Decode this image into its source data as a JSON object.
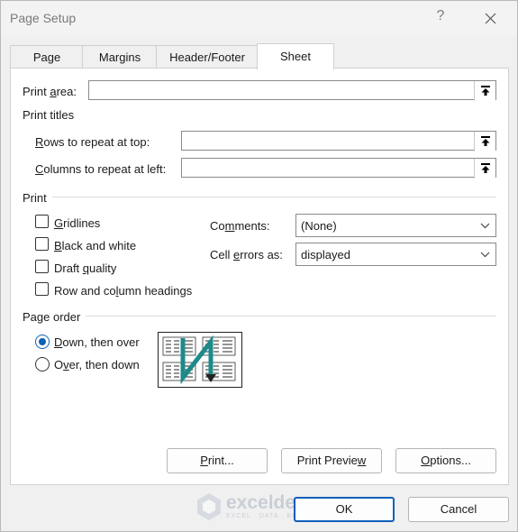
{
  "window": {
    "title": "Page Setup",
    "help_label": "?"
  },
  "tabs": [
    {
      "label": "Page"
    },
    {
      "label": "Margins"
    },
    {
      "label": "Header/Footer"
    },
    {
      "label": "Sheet",
      "active": true
    }
  ],
  "print_area": {
    "label_pre": "Print ",
    "label_u": "a",
    "label_post": "rea:",
    "value": ""
  },
  "print_titles": {
    "label": "Print titles",
    "rows": {
      "label_u": "R",
      "label_post": "ows to repeat at top:",
      "value": ""
    },
    "cols": {
      "label_u": "C",
      "label_post": "olumns to repeat at left:",
      "value": ""
    }
  },
  "print_group": {
    "label": "Print",
    "gridlines": {
      "label_u": "G",
      "label_post": "ridlines",
      "checked": false
    },
    "black_white": {
      "label_u": "B",
      "label_post": "lack and white",
      "checked": false
    },
    "draft": {
      "label_pre": "Draft ",
      "label_u": "q",
      "label_post": "uality",
      "checked": false
    },
    "headings": {
      "label_pre": "Row and co",
      "label_u": "l",
      "label_post": "umn headings",
      "checked": false
    },
    "comments": {
      "label_pre": "Co",
      "label_u": "m",
      "label_post": "ments:",
      "value": "(None)"
    },
    "cell_errors": {
      "label_pre": "Cell ",
      "label_u": "e",
      "label_post": "rrors as:",
      "value": "displayed"
    }
  },
  "page_order": {
    "label": "Page order",
    "down_then_over": {
      "label_u": "D",
      "label_post": "own, then over",
      "selected": true
    },
    "over_then_down": {
      "label_pre": "O",
      "label_u": "v",
      "label_post": "er, then down",
      "selected": false
    }
  },
  "buttons": {
    "print": {
      "label_u": "P",
      "label_post": "rint..."
    },
    "print_preview": {
      "label_pre": "Print Previe",
      "label_u": "w",
      "label_post": ""
    },
    "options": {
      "label_u": "O",
      "label_post": "ptions..."
    },
    "ok": "OK",
    "cancel": "Cancel"
  },
  "watermark": {
    "name": "exceldemy",
    "tagline": "EXCEL · DATA · BI"
  },
  "colors": {
    "accent": "#0f5fb8",
    "order_arrow": "#1e8a8a"
  }
}
